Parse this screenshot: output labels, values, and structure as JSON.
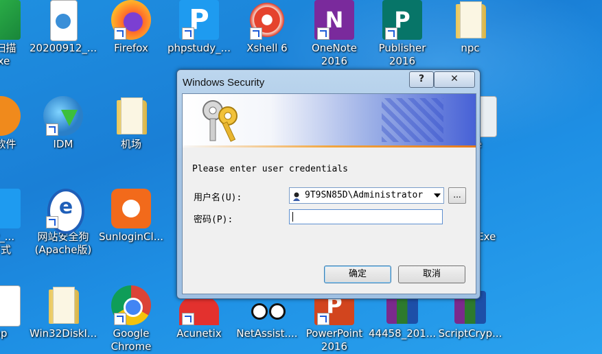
{
  "desktop": {
    "icons": [
      {
        "label1": "台扫描",
        "label2": "exe"
      },
      {
        "label1": "20200912_...",
        "label2": ""
      },
      {
        "label1": "Firefox",
        "label2": ""
      },
      {
        "label1": "phpstudy_...",
        "label2": ""
      },
      {
        "label1": "Xshell 6",
        "label2": ""
      },
      {
        "label1": "OneNote",
        "label2": "2016"
      },
      {
        "label1": "Publisher",
        "label2": "2016"
      },
      {
        "label1": "npc",
        "label2": ""
      },
      {
        "label1": "全软件",
        "label2": ""
      },
      {
        "label1": "IDM",
        "label2": ""
      },
      {
        "label1": "机场",
        "label2": ""
      },
      {
        "label1": "xe",
        "label2": ""
      },
      {
        "label1": "dy_...",
        "label2": "方式"
      },
      {
        "label1": "网站安全狗",
        "label2": "(Apache版)"
      },
      {
        "label1": "SunloginCl...",
        "label2": ""
      },
      {
        "label1": "_Exe",
        "label2": ""
      },
      {
        "label1": "np",
        "label2": ""
      },
      {
        "label1": "Win32DiskI...",
        "label2": ""
      },
      {
        "label1": "Google",
        "label2": "Chrome"
      },
      {
        "label1": "Acunetix",
        "label2": ""
      },
      {
        "label1": "NetAssist....",
        "label2": ""
      },
      {
        "label1": "PowerPoint",
        "label2": "2016"
      },
      {
        "label1": "44458_201...",
        "label2": ""
      },
      {
        "label1": "ScriptCryp...",
        "label2": ""
      }
    ]
  },
  "dialog": {
    "title": "Windows Security",
    "help_label": "?",
    "close_label": "✕",
    "message": "Please enter user credentials",
    "username_label": "用户名(U):",
    "username_value": "9T9SN85D\\Administrator",
    "browse_label": "...",
    "password_label": "密码(P):",
    "password_value": "",
    "ok_label": "确定",
    "cancel_label": "取消"
  },
  "colors": {
    "accent": "#1a7fd6",
    "banner": "#4761d6",
    "stripe": "#e67a1c"
  }
}
